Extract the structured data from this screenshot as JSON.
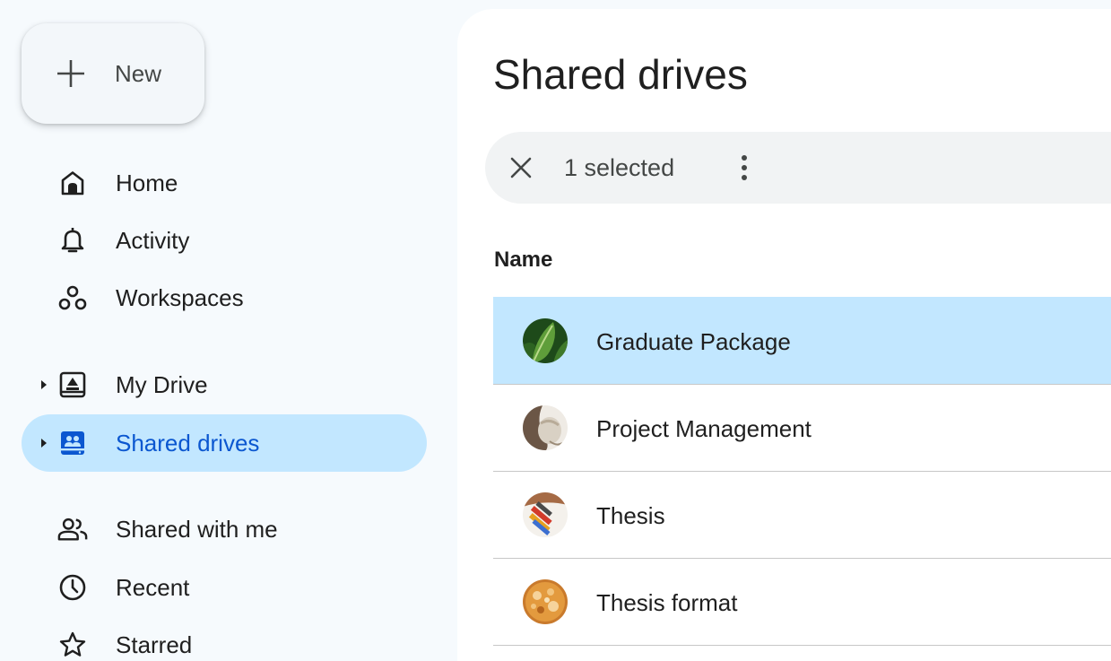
{
  "new_button": {
    "label": "New",
    "icon": "plus-icon"
  },
  "sidebar": {
    "items": [
      {
        "label": "Home",
        "icon": "home-icon"
      },
      {
        "label": "Activity",
        "icon": "bell-icon"
      },
      {
        "label": "Workspaces",
        "icon": "workspaces-icon"
      },
      {
        "label": "My Drive",
        "icon": "drive-icon",
        "expandable": true
      },
      {
        "label": "Shared drives",
        "icon": "shared-drives-icon",
        "expandable": true,
        "active": true
      },
      {
        "label": "Shared with me",
        "icon": "people-icon"
      },
      {
        "label": "Recent",
        "icon": "clock-icon"
      },
      {
        "label": "Starred",
        "icon": "star-icon"
      }
    ]
  },
  "main": {
    "title": "Shared drives",
    "selection": {
      "count_label": "1 selected",
      "clear_icon": "close-icon",
      "more_icon": "more-vert-icon"
    },
    "table": {
      "columns": [
        "Name"
      ],
      "rows": [
        {
          "name": "Graduate Package",
          "selected": true,
          "avatar": "leaf-thumbnail"
        },
        {
          "name": "Project Management",
          "selected": false,
          "avatar": "bowl-thumbnail"
        },
        {
          "name": "Thesis",
          "selected": false,
          "avatar": "pencils-thumbnail"
        },
        {
          "name": "Thesis format",
          "selected": false,
          "avatar": "bread-thumbnail"
        }
      ]
    }
  },
  "colors": {
    "selected_bg": "#c2e7ff",
    "active_text": "#0b57d0",
    "sidebar_bg": "#f6fafd",
    "selection_bar_bg": "#f1f3f4",
    "divider": "#c7c7c7"
  }
}
